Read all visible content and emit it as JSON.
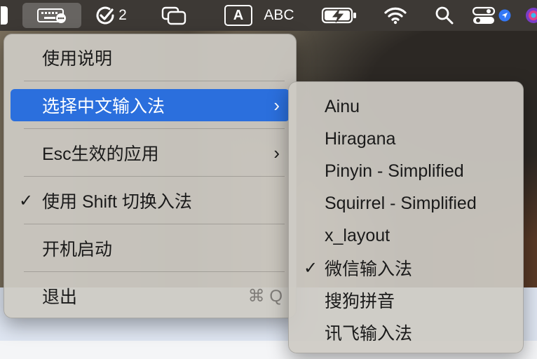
{
  "menubar": {
    "input_icon": "keyboard-icon",
    "reminders_count": "2",
    "input_source_letter": "A",
    "input_source_label": "ABC"
  },
  "menu": {
    "items": [
      {
        "label": "使用说明",
        "checked": false,
        "submenu": false
      },
      {
        "label": "选择中文输入法",
        "checked": false,
        "submenu": true,
        "selected": true
      },
      {
        "label": "Esc生效的应用",
        "checked": false,
        "submenu": true
      },
      {
        "label": "使用 Shift 切换入法",
        "checked": true,
        "submenu": false
      },
      {
        "label": "开机启动",
        "checked": false,
        "submenu": false
      },
      {
        "label": "退出",
        "checked": false,
        "submenu": false,
        "shortcut": "⌘ Q"
      }
    ],
    "check_glyph": "✓",
    "chevron_glyph": "›"
  },
  "submenu": {
    "items": [
      {
        "label": "Ainu",
        "checked": false
      },
      {
        "label": "Hiragana",
        "checked": false
      },
      {
        "label": "Pinyin - Simplified",
        "checked": false
      },
      {
        "label": "Squirrel - Simplified",
        "checked": false
      },
      {
        "label": "x_layout",
        "checked": false
      },
      {
        "label": "微信输入法",
        "checked": true
      },
      {
        "label": "搜狗拼音",
        "checked": false
      },
      {
        "label": "讯飞输入法",
        "checked": false
      }
    ]
  },
  "colors": {
    "selection": "#2b6fdd",
    "menubar_bg": "#3e3a36",
    "menu_bg": "#cdcac4"
  }
}
